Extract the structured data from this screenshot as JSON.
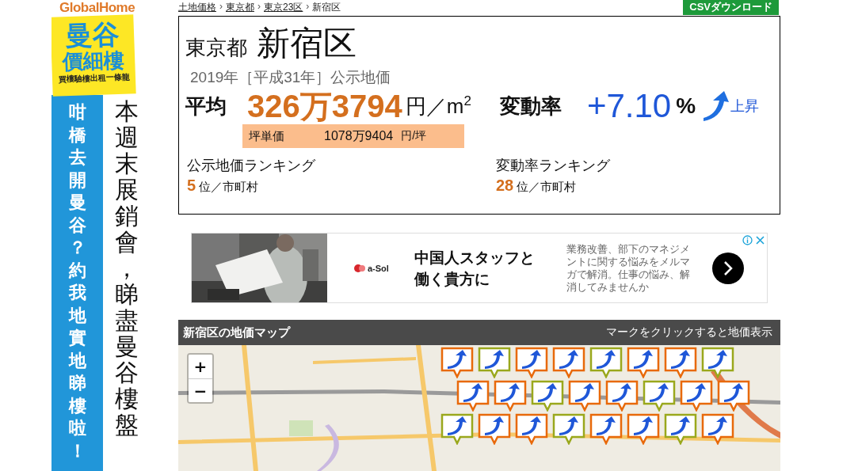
{
  "banner": {
    "logo": "GlobalHome",
    "sign_title": "曼谷",
    "sign_subtitle": "價細樓",
    "sign_tagline": "買樓驗樓出租一條龍",
    "blue_column": "咁橋去開曼谷？約我地實地睇樓啦！",
    "side_column": "本週末展銷會，睇盡曼谷樓盤"
  },
  "breadcrumb": {
    "separator": "›",
    "items": [
      "土地価格",
      "東京都",
      "東京23区",
      "新宿区"
    ]
  },
  "csv_button": "CSVダウンロード",
  "summary": {
    "prefecture": "東京都",
    "city": "新宿区",
    "year": "2019年［平成31年］公示地価",
    "average_label": "平均",
    "average_value": "326万3794",
    "average_unit": "円／m$^{2}$",
    "change_label": "変動率",
    "change_value": "+7.10",
    "change_unit": "%",
    "trend_label": "上昇",
    "tsubo_label": "坪単価",
    "tsubo_value": "1078万9404",
    "tsubo_unit": "円/坪",
    "rankings": [
      {
        "title": "公示地価ランキング",
        "rank": "5",
        "suffix": "位／市町村"
      },
      {
        "title": "変動率ランキング",
        "rank": "28",
        "suffix": "位／市町村"
      }
    ]
  },
  "ad": {
    "kind": "picture",
    "logo": "a-Sol",
    "headline": "中国人スタッフと働く貴方に",
    "body": "業務改善、部下のマネジメントに関する悩みをメルマガで解消。仕事の悩み、解消してみませんか"
  },
  "map": {
    "title": "新宿区の地価マップ",
    "hint": "マークをクリックすると地価表示",
    "zoom_in": "+",
    "zoom_out": "−"
  }
}
